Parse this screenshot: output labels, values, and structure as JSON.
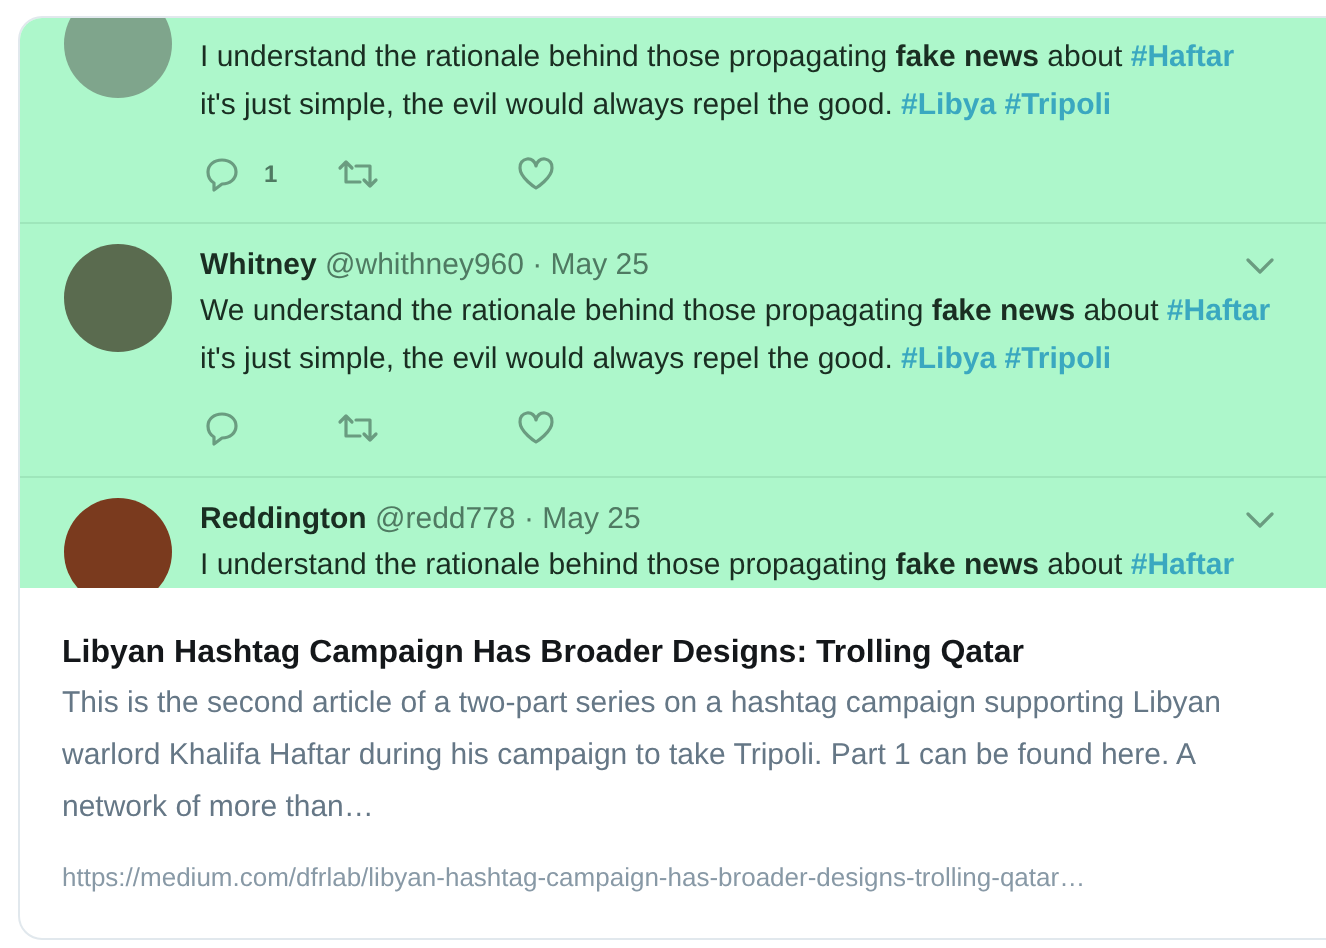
{
  "preview_image": {
    "tweets": [
      {
        "lines": [
          [
            {
              "kind": "plain",
              "text": "I understand the rationale behind those propagating "
            },
            {
              "kind": "bold",
              "text": "fake news"
            },
            {
              "kind": "plain",
              "text": " about "
            },
            {
              "kind": "hashtag",
              "text": "#Haftar"
            }
          ],
          [
            {
              "kind": "plain",
              "text": "it's just simple, the evil would always repel the good. "
            },
            {
              "kind": "hashtag",
              "text": "#Libya #Tripoli"
            }
          ]
        ],
        "reply_count": "1",
        "show_actions": true
      },
      {
        "name": "Whitney",
        "handle": "@whithney960 · May 25",
        "lines": [
          [
            {
              "kind": "plain",
              "text": "We understand the rationale behind those propagating "
            },
            {
              "kind": "bold",
              "text": "fake news"
            },
            {
              "kind": "plain",
              "text": " about "
            },
            {
              "kind": "hashtag",
              "text": "#Haftar"
            }
          ],
          [
            {
              "kind": "plain",
              "text": "it's just simple, the evil would always repel the good. "
            },
            {
              "kind": "hashtag",
              "text": "#Libya #Tripoli"
            }
          ]
        ],
        "show_actions": true
      },
      {
        "name": "Reddington",
        "handle": "@redd778 · May 25",
        "lines": [
          [
            {
              "kind": "plain",
              "text": "I understand the rationale behind those propagating "
            },
            {
              "kind": "bold",
              "text": "fake news"
            },
            {
              "kind": "plain",
              "text": " about "
            },
            {
              "kind": "hashtag",
              "text": "#Haftar"
            }
          ]
        ],
        "show_actions": false
      }
    ]
  },
  "title": "Libyan Hashtag Campaign Has Broader Designs: Trolling Qatar",
  "description": "This is the second article of a two-part series on a hashtag campaign supporting Libyan warlord Khalifa Haftar during his campaign to take Tripoli. Part 1 can be found here. A network of more than…",
  "url": "https://medium.com/dfrlab/libyan-hashtag-campaign-has-broader-designs-trolling-qatar…"
}
